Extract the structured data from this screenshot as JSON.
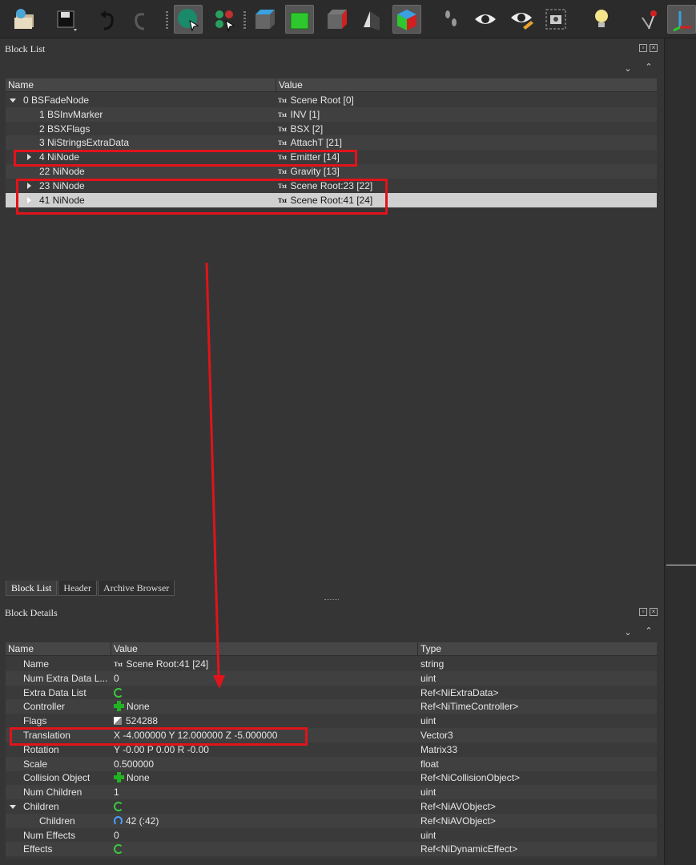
{
  "toolbar": {
    "icons": [
      "load-icon",
      "save-icon",
      "undo-icon",
      "redo-icon",
      "select-object-icon",
      "select-vertex-icon",
      "view-top-icon",
      "view-front-icon",
      "view-side-icon",
      "view-walk-icon",
      "view-user-icon",
      "footprints-icon",
      "eye-icon",
      "eye-edit-icon",
      "screenshot-icon",
      "lightbulb-icon",
      "pin-icon",
      "axes-icon"
    ]
  },
  "block_list": {
    "title": "Block List",
    "columns": [
      "Name",
      "Value"
    ],
    "rows": [
      {
        "name": "0 BSFadeNode",
        "value": "Scene Root [0]",
        "indent": 0,
        "expander": "down"
      },
      {
        "name": "1 BSInvMarker",
        "value": "INV [1]",
        "indent": 1,
        "expander": ""
      },
      {
        "name": "2 BSXFlags",
        "value": "BSX [2]",
        "indent": 1,
        "expander": ""
      },
      {
        "name": "3 NiStringsExtraData",
        "value": "AttachT [21]",
        "indent": 1,
        "expander": ""
      },
      {
        "name": "4 NiNode",
        "value": "Emitter [14]",
        "indent": 1,
        "expander": "right"
      },
      {
        "name": "22 NiNode",
        "value": "Gravity [13]",
        "indent": 1,
        "expander": ""
      },
      {
        "name": "23 NiNode",
        "value": "Scene Root:23 [22]",
        "indent": 1,
        "expander": "right"
      },
      {
        "name": "41 NiNode",
        "value": "Scene Root:41 [24]",
        "indent": 1,
        "expander": "right",
        "selected": true
      }
    ]
  },
  "tabs": [
    "Block List",
    "Header",
    "Archive Browser"
  ],
  "block_details": {
    "title": "Block Details",
    "columns": [
      "Name",
      "Value",
      "Type"
    ],
    "rows": [
      {
        "name": "Name",
        "value": "Scene Root:41 [24]",
        "type": "string",
        "icon": "txt"
      },
      {
        "name": "Num Extra Data L...",
        "value": "0",
        "type": "uint",
        "icon": ""
      },
      {
        "name": "Extra Data List",
        "value": "",
        "type": "Ref<NiExtraData>",
        "icon": "recycle"
      },
      {
        "name": "Controller",
        "value": "None",
        "type": "Ref<NiTimeController>",
        "icon": "plus"
      },
      {
        "name": "Flags",
        "value": "524288",
        "type": "uint",
        "icon": "flag"
      },
      {
        "name": "Translation",
        "value": "X -4.000000 Y 12.000000 Z -5.000000",
        "type": "Vector3",
        "icon": ""
      },
      {
        "name": "Rotation",
        "value": "Y -0.00 P 0.00 R -0.00",
        "type": "Matrix33",
        "icon": ""
      },
      {
        "name": "Scale",
        "value": "0.500000",
        "type": "float",
        "icon": ""
      },
      {
        "name": "Collision Object",
        "value": "None",
        "type": "Ref<NiCollisionObject>",
        "icon": "plus"
      },
      {
        "name": "Num Children",
        "value": "1",
        "type": "uint",
        "icon": ""
      },
      {
        "name": "Children",
        "value": "",
        "type": "Ref<NiAVObject>",
        "icon": "recycle",
        "expander": "down"
      },
      {
        "name": "Children",
        "value": "42 (:42)",
        "type": "Ref<NiAVObject>",
        "icon": "link",
        "indent": 1
      },
      {
        "name": "Num Effects",
        "value": "0",
        "type": "uint",
        "icon": ""
      },
      {
        "name": "Effects",
        "value": "",
        "type": "Ref<NiDynamicEffect>",
        "icon": "recycle"
      }
    ]
  },
  "colors": {
    "highlight": "#e0141a",
    "selected_row": "#d0d0d0",
    "background": "#353535"
  }
}
